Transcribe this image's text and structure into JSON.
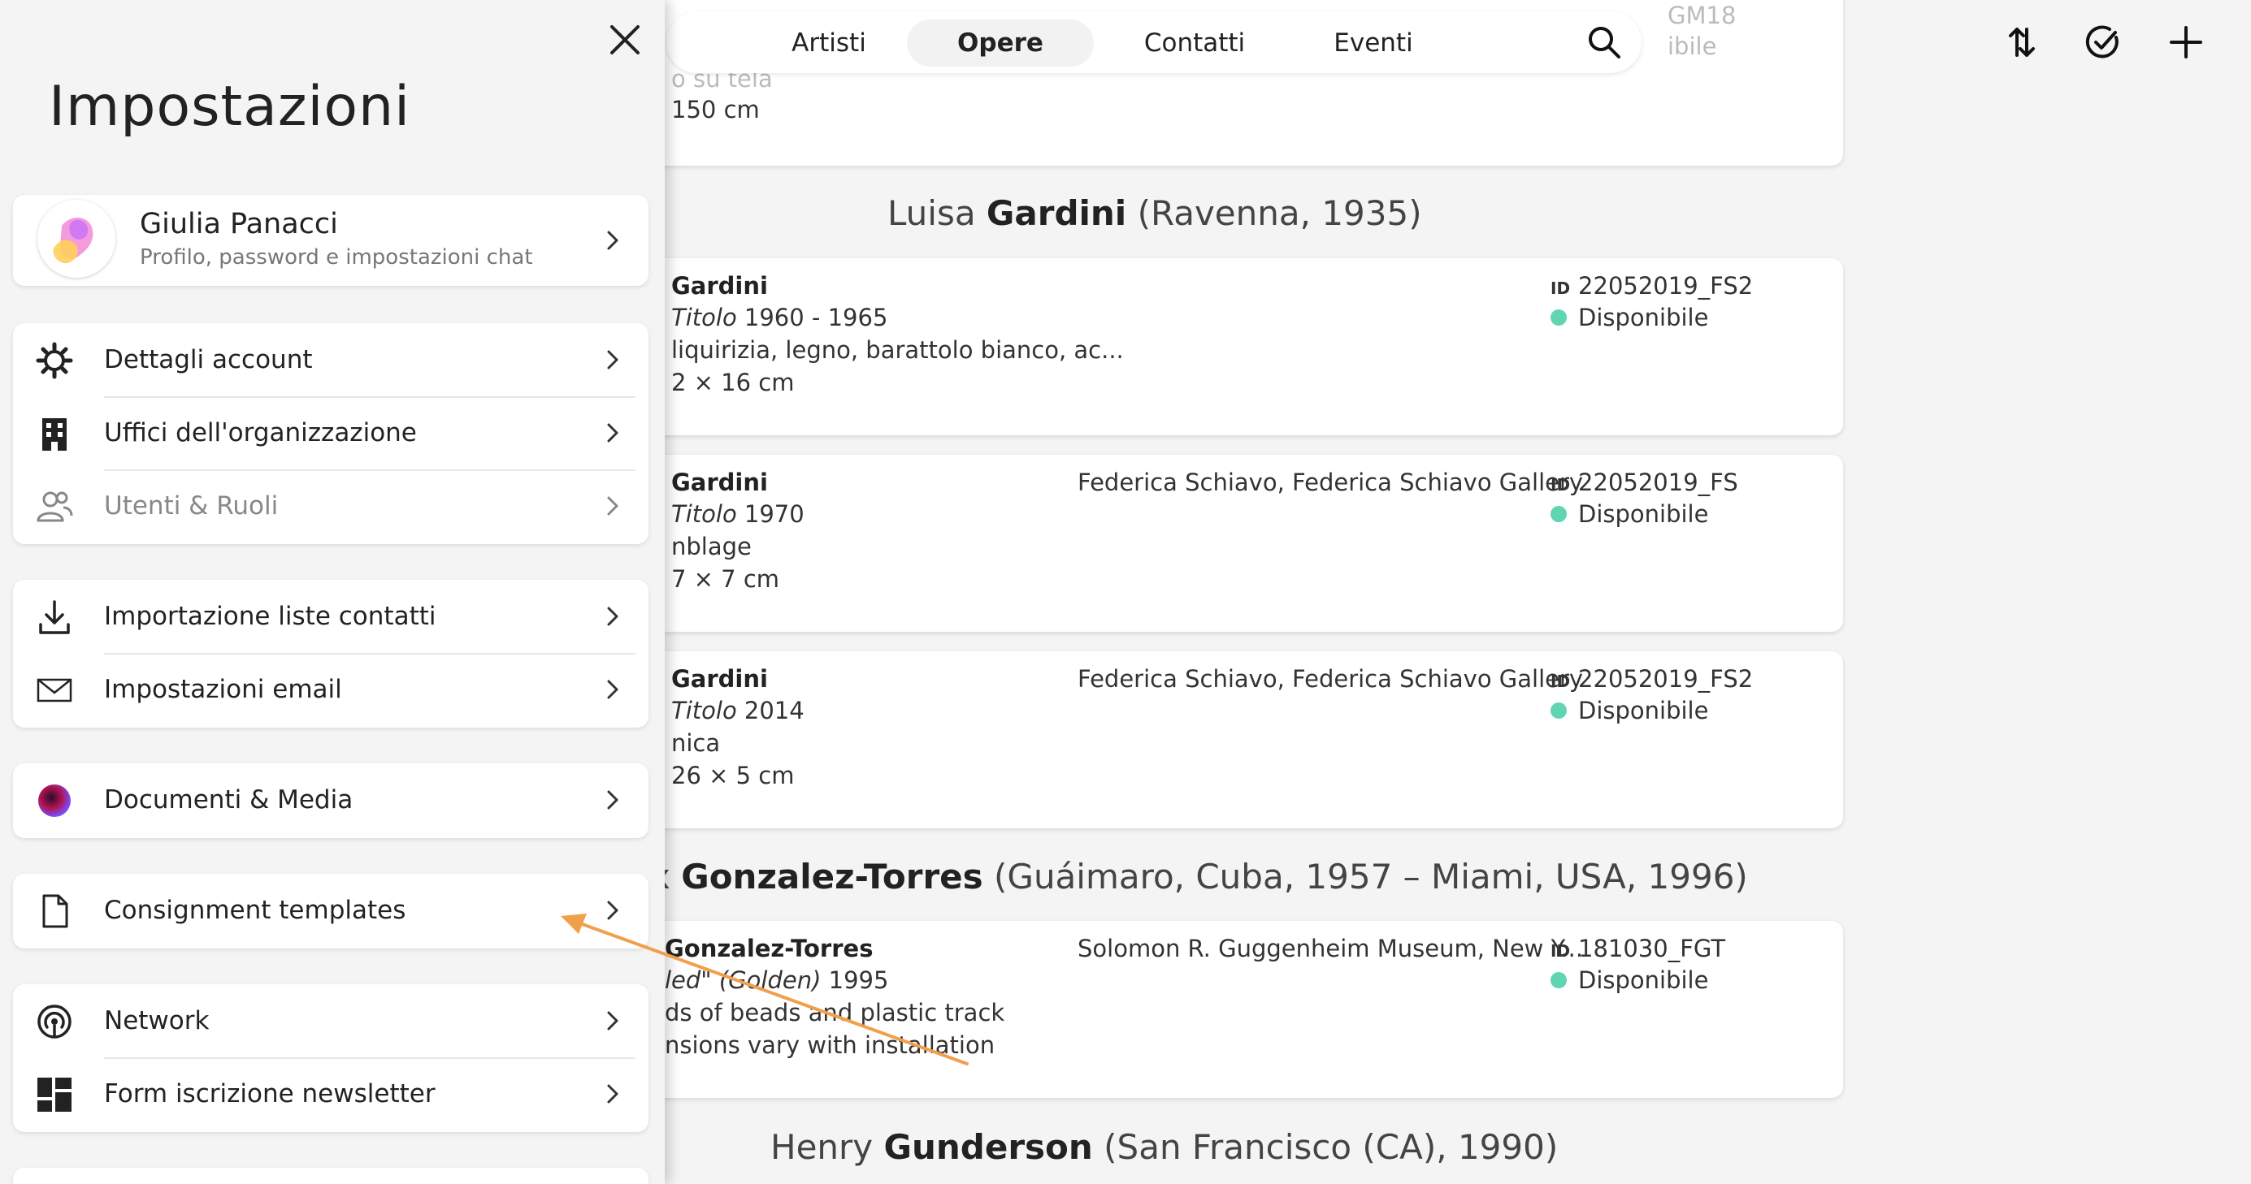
{
  "nav": {
    "tabs": [
      "Artisti",
      "Opere",
      "Contatti",
      "Eventi"
    ],
    "active_tab": "Opere"
  },
  "top_actions": [
    "sort-icon",
    "check-circle-icon",
    "plus-icon"
  ],
  "list": {
    "top_partial": {
      "faded_line": "o su tela",
      "dims": "150 cm",
      "faded_id": "GM18",
      "faded_status": "ibile"
    },
    "artist1_heading": {
      "first": "Luisa ",
      "last": "Gardini",
      "rest": " (Ravenna, 1935)"
    },
    "artworks": [
      {
        "artist": "Gardini",
        "title_label": "Titolo",
        "year": " 1960 - 1965",
        "material": "liquirizia, legno, barattolo bianco, ac...",
        "dims": "2 × 16 cm",
        "owner": "",
        "id": "22052019_FS2",
        "status": "Disponibile"
      },
      {
        "artist": "Gardini",
        "title_label": "Titolo",
        "year": " 1970",
        "material": "nblage",
        "dims": "7 × 7 cm",
        "owner": "Federica Schiavo, Federica Schiavo Gallery",
        "id": "22052019_FS",
        "status": "Disponibile"
      },
      {
        "artist": "Gardini",
        "title_label": "Titolo",
        "year": " 2014",
        "material": "nica",
        "dims": "26 × 5 cm",
        "owner": "Federica Schiavo, Federica Schiavo Gallery",
        "id": "22052019_FS2",
        "status": "Disponibile"
      }
    ],
    "artist2_heading": {
      "first": "x ",
      "last": "Gonzalez-Torres",
      "rest": " (Guáimaro, Cuba, 1957 – Miami, USA, 1996)"
    },
    "artwork_gt": {
      "artist": "Gonzalez-Torres",
      "title_label": "led\" (Golden)",
      "year": " 1995",
      "material": "ds of beads and plastic track",
      "dims": "nsions vary with installation",
      "owner": "Solomon R. Guggenheim Museum, New Y...",
      "id": "181030_FGT",
      "status": "Disponibile"
    },
    "artist3_heading": {
      "first": "Henry ",
      "last": "Gunderson",
      "rest": " (San Francisco (CA), 1990)"
    },
    "id_label": "ID"
  },
  "settings": {
    "title": "Impostazioni",
    "profile": {
      "name": "Giulia Panacci",
      "subtitle": "Profilo, password e impostazioni chat"
    },
    "account_group": [
      {
        "label": "Dettagli account",
        "icon": "gear-icon"
      },
      {
        "label": "Uffici dell'organizzazione",
        "icon": "building-icon"
      },
      {
        "label": "Utenti & Ruoli",
        "icon": "users-icon"
      }
    ],
    "import_group": [
      {
        "label": "Importazione liste contatti",
        "icon": "download-icon"
      },
      {
        "label": "Impostazioni email",
        "icon": "envelope-icon"
      }
    ],
    "docs_item": {
      "label": "Documenti & Media",
      "icon": "media-orb-icon"
    },
    "consignment_item": {
      "label": "Consignment templates",
      "icon": "document-icon"
    },
    "network_group": [
      {
        "label": "Network",
        "icon": "network-icon"
      },
      {
        "label": "Form iscrizione newsletter",
        "icon": "grid-layout-icon"
      }
    ]
  },
  "colors": {
    "accent_arrow": "#f0a04b",
    "status_available": "#5fd5b1"
  }
}
